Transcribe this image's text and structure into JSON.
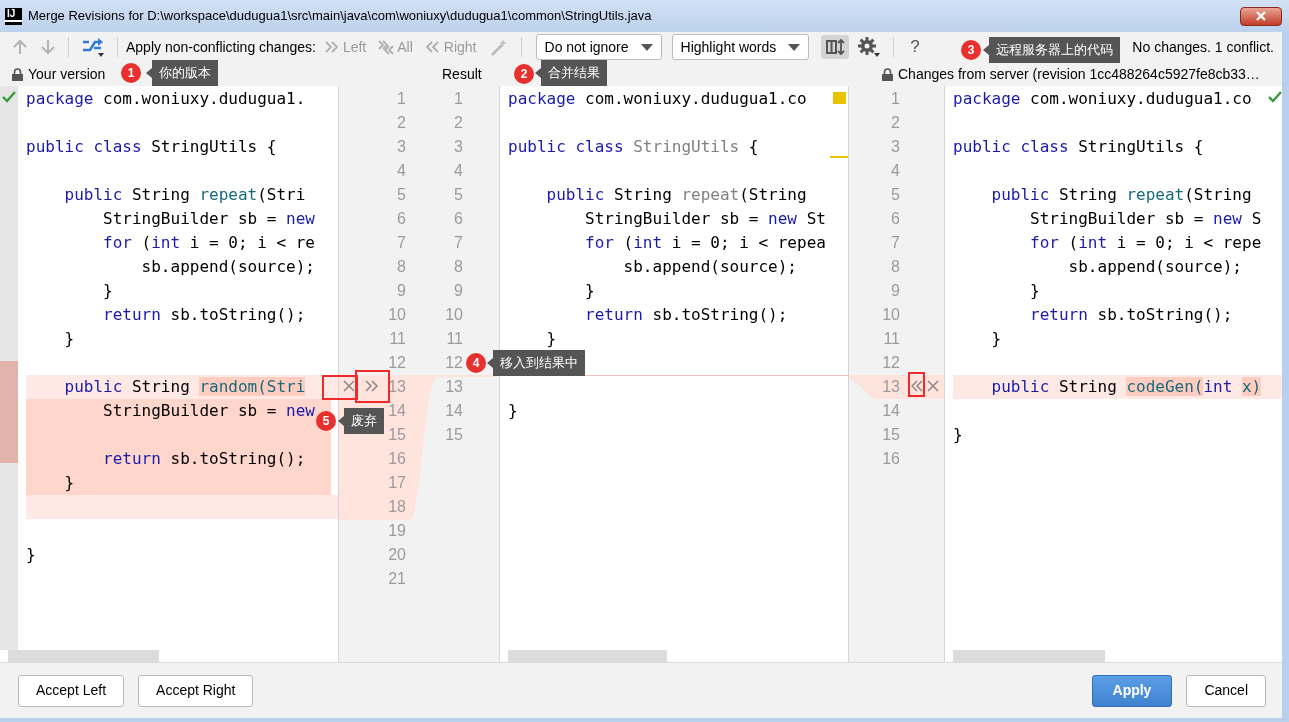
{
  "window": {
    "logo": "IJ",
    "title": "Merge Revisions for D:\\workspace\\dudugua1\\src\\main\\java\\com\\woniuxy\\dudugua1\\common\\StringUtils.java"
  },
  "toolbar": {
    "nav": [
      {
        "disabled": true
      },
      {
        "disabled": true
      }
    ],
    "apply_label": "Apply non-conflicting changes:",
    "apply_buttons": [
      {
        "label": "Left",
        "disabled": true
      },
      {
        "label": "All",
        "disabled": true
      },
      {
        "label": "Right",
        "disabled": true
      }
    ],
    "dropdowns": [
      {
        "value": "Do not ignore"
      },
      {
        "value": "Highlight words"
      }
    ],
    "sync_scroll": {
      "pressed": true
    },
    "help": "?",
    "status": "No changes. 1 conflict."
  },
  "panes": [
    {
      "title": "Your version",
      "locked": true,
      "line_numbers": [
        "1",
        "2",
        "3",
        "4",
        "5",
        "6",
        "7",
        "8",
        "9",
        "10",
        "11",
        "12",
        "13",
        "14",
        "15",
        "16",
        "17",
        "18",
        "19",
        "20",
        "21"
      ],
      "lines": [
        {
          "kind": "normal",
          "tokens": [
            {
              "kind": "keyword",
              "text": "package"
            },
            {
              "kind": "plain",
              "text": " com.woniuxy.dudugua1."
            }
          ]
        },
        {
          "kind": "normal"
        },
        {
          "kind": "normal",
          "tokens": [
            {
              "kind": "keyword",
              "text": "public class"
            },
            {
              "kind": "plain",
              "text": " StringUtils {"
            }
          ]
        },
        {
          "kind": "normal"
        },
        {
          "kind": "normal",
          "tokens": [
            {
              "kind": "keyword",
              "text": "    public"
            },
            {
              "kind": "plain",
              "text": " String "
            },
            {
              "kind": "method",
              "text": "repeat"
            },
            {
              "kind": "plain",
              "text": "(Stri"
            }
          ]
        },
        {
          "kind": "normal",
          "tokens": [
            {
              "kind": "plain",
              "text": "        StringBuilder sb = "
            },
            {
              "kind": "keyword",
              "text": "new"
            }
          ]
        },
        {
          "kind": "normal",
          "tokens": [
            {
              "kind": "keyword",
              "text": "        for"
            },
            {
              "kind": "plain",
              "text": " ("
            },
            {
              "kind": "keyword",
              "text": "int"
            },
            {
              "kind": "plain",
              "text": " i = 0; i < re"
            }
          ]
        },
        {
          "kind": "normal",
          "tokens": [
            {
              "kind": "plain",
              "text": "            sb.append(source);"
            }
          ]
        },
        {
          "kind": "normal",
          "tokens": [
            {
              "kind": "plain",
              "text": "        }"
            }
          ]
        },
        {
          "kind": "normal",
          "tokens": [
            {
              "kind": "keyword",
              "text": "        return"
            },
            {
              "kind": "plain",
              "text": " sb.toString();"
            }
          ]
        },
        {
          "kind": "normal",
          "tokens": [
            {
              "kind": "plain",
              "text": "    }"
            }
          ]
        },
        {
          "kind": "normal"
        },
        {
          "kind": "conflict",
          "tokens": [
            {
              "kind": "keyword",
              "text": "    public"
            },
            {
              "kind": "plain",
              "text": " String "
            },
            {
              "kind": "changed",
              "text": "random(Stri"
            }
          ]
        },
        {
          "kind": "conflict-strong",
          "tokens": [
            {
              "kind": "plain",
              "text": "        StringBuilder sb = "
            },
            {
              "kind": "keyword",
              "text": "new"
            }
          ]
        },
        {
          "kind": "conflict-strong"
        },
        {
          "kind": "conflict-strong",
          "tokens": [
            {
              "kind": "keyword",
              "text": "        return"
            },
            {
              "kind": "plain",
              "text": " sb.toString();"
            }
          ]
        },
        {
          "kind": "conflict-strong",
          "tokens": [
            {
              "kind": "plain",
              "text": "    }"
            }
          ]
        },
        {
          "kind": "conflict"
        },
        {
          "kind": "normal"
        },
        {
          "kind": "normal",
          "tokens": [
            {
              "kind": "plain",
              "text": "}"
            }
          ]
        },
        {
          "kind": "normal"
        }
      ]
    },
    {
      "title": "Result",
      "locked": false,
      "line_numbers": [
        "1",
        "2",
        "3",
        "4",
        "5",
        "6",
        "7",
        "8",
        "9",
        "10",
        "11",
        "12",
        "13",
        "14",
        "15"
      ],
      "lines": [
        {
          "kind": "normal",
          "tokens": [
            {
              "kind": "keyword",
              "text": "package"
            },
            {
              "kind": "plain",
              "text": " com.woniuxy.dudugua1.co"
            }
          ]
        },
        {
          "kind": "normal"
        },
        {
          "kind": "normal",
          "tokens": [
            {
              "kind": "keyword",
              "text": "public class "
            },
            {
              "kind": "unused",
              "text": "StringUtils"
            },
            {
              "kind": "plain",
              "text": " {"
            }
          ]
        },
        {
          "kind": "normal"
        },
        {
          "kind": "normal",
          "tokens": [
            {
              "kind": "keyword",
              "text": "    public"
            },
            {
              "kind": "plain",
              "text": " String "
            },
            {
              "kind": "unused",
              "text": "repeat"
            },
            {
              "kind": "plain",
              "text": "(String"
            }
          ]
        },
        {
          "kind": "normal",
          "tokens": [
            {
              "kind": "plain",
              "text": "        StringBuilder sb = "
            },
            {
              "kind": "keyword",
              "text": "new"
            },
            {
              "kind": "plain",
              "text": " St"
            }
          ]
        },
        {
          "kind": "normal",
          "tokens": [
            {
              "kind": "keyword",
              "text": "        for"
            },
            {
              "kind": "plain",
              "text": " ("
            },
            {
              "kind": "keyword",
              "text": "int"
            },
            {
              "kind": "plain",
              "text": " i = 0; i < repea"
            }
          ]
        },
        {
          "kind": "normal",
          "tokens": [
            {
              "kind": "plain",
              "text": "            sb.append(source);"
            }
          ]
        },
        {
          "kind": "normal",
          "tokens": [
            {
              "kind": "plain",
              "text": "        }"
            }
          ]
        },
        {
          "kind": "normal",
          "tokens": [
            {
              "kind": "keyword",
              "text": "        return"
            },
            {
              "kind": "plain",
              "text": " sb.toString();"
            }
          ]
        },
        {
          "kind": "normal",
          "tokens": [
            {
              "kind": "plain",
              "text": "    }"
            }
          ]
        },
        {
          "kind": "normal"
        },
        {
          "kind": "conflict-edge"
        },
        {
          "kind": "normal",
          "tokens": [
            {
              "kind": "plain",
              "text": "}"
            }
          ]
        },
        {
          "kind": "normal"
        }
      ]
    },
    {
      "title": "Changes from server (revision 1cc488264c5927fe8cb33…",
      "locked": true,
      "line_numbers": [
        "1",
        "2",
        "3",
        "4",
        "5",
        "6",
        "7",
        "8",
        "9",
        "10",
        "11",
        "12",
        "13",
        "14",
        "15",
        "16"
      ],
      "lines": [
        {
          "kind": "normal",
          "tokens": [
            {
              "kind": "keyword",
              "text": "package"
            },
            {
              "kind": "plain",
              "text": " com.woniuxy.dudugua1.co"
            }
          ]
        },
        {
          "kind": "normal"
        },
        {
          "kind": "normal",
          "tokens": [
            {
              "kind": "keyword",
              "text": "public class"
            },
            {
              "kind": "plain",
              "text": " StringUtils {"
            }
          ]
        },
        {
          "kind": "normal"
        },
        {
          "kind": "normal",
          "tokens": [
            {
              "kind": "keyword",
              "text": "    public"
            },
            {
              "kind": "plain",
              "text": " String "
            },
            {
              "kind": "method",
              "text": "repeat"
            },
            {
              "kind": "plain",
              "text": "(String"
            }
          ]
        },
        {
          "kind": "normal",
          "tokens": [
            {
              "kind": "plain",
              "text": "        StringBuilder sb = "
            },
            {
              "kind": "keyword",
              "text": "new"
            },
            {
              "kind": "plain",
              "text": " S"
            }
          ]
        },
        {
          "kind": "normal",
          "tokens": [
            {
              "kind": "keyword",
              "text": "        for"
            },
            {
              "kind": "plain",
              "text": " ("
            },
            {
              "kind": "keyword",
              "text": "int"
            },
            {
              "kind": "plain",
              "text": " i = 0; i < repe"
            }
          ]
        },
        {
          "kind": "normal",
          "tokens": [
            {
              "kind": "plain",
              "text": "            sb.append(source);"
            }
          ]
        },
        {
          "kind": "normal",
          "tokens": [
            {
              "kind": "plain",
              "text": "        }"
            }
          ]
        },
        {
          "kind": "normal",
          "tokens": [
            {
              "kind": "keyword",
              "text": "        return"
            },
            {
              "kind": "plain",
              "text": " sb.toString();"
            }
          ]
        },
        {
          "kind": "normal",
          "tokens": [
            {
              "kind": "plain",
              "text": "    }"
            }
          ]
        },
        {
          "kind": "normal"
        },
        {
          "kind": "conflict",
          "tokens": [
            {
              "kind": "keyword",
              "text": "    public"
            },
            {
              "kind": "plain",
              "text": " String "
            },
            {
              "kind": "changed",
              "text": "codeGen("
            },
            {
              "kind": "keyword",
              "text": "int "
            },
            {
              "kind": "changed",
              "text": "x)"
            }
          ]
        },
        {
          "kind": "normal"
        },
        {
          "kind": "normal",
          "tokens": [
            {
              "kind": "plain",
              "text": "}"
            }
          ]
        },
        {
          "kind": "normal"
        }
      ]
    }
  ],
  "annotations": [
    {
      "number": "1",
      "text": "你的版本"
    },
    {
      "number": "2",
      "text": "合并结果"
    },
    {
      "number": "3",
      "text": "远程服务器上的代码"
    },
    {
      "number": "4",
      "text": "移入到结果中"
    },
    {
      "number": "5",
      "text": "废弃"
    }
  ],
  "footer": {
    "left_buttons": [
      "Accept Left",
      "Accept Right"
    ],
    "right_buttons": [
      {
        "label": "Apply",
        "primary": true
      },
      {
        "label": "Cancel",
        "primary": false
      }
    ]
  }
}
